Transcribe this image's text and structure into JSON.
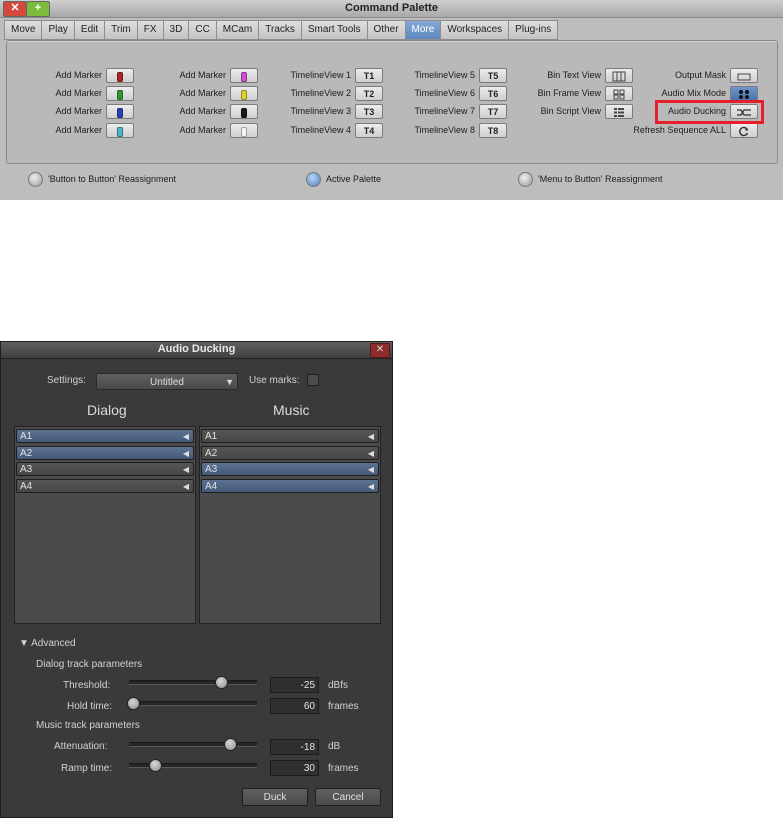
{
  "command_palette": {
    "title": "Command Palette",
    "close_glyph": "✕",
    "add_glyph": "+",
    "tabs": [
      "Move",
      "Play",
      "Edit",
      "Trim",
      "FX",
      "3D",
      "CC",
      "MCam",
      "Tracks",
      "Smart Tools",
      "Other",
      "More",
      "Workspaces",
      "Plug-ins"
    ],
    "active_tab": "More",
    "markers": [
      {
        "label": "Add Marker",
        "color": "#b02525"
      },
      {
        "label": "Add Marker",
        "color": "#2e9a2e"
      },
      {
        "label": "Add Marker",
        "color": "#2b3fbf"
      },
      {
        "label": "Add Marker",
        "color": "#4fb5c9"
      },
      {
        "label": "Add Marker",
        "color": "#d04fd0"
      },
      {
        "label": "Add Marker",
        "color": "#e0d22a"
      },
      {
        "label": "Add Marker",
        "color": "#1a1a1a"
      },
      {
        "label": "Add Marker",
        "color": "#f4f4f4"
      }
    ],
    "timeline_views": [
      {
        "label": "TimelineView 1",
        "btn": "T1"
      },
      {
        "label": "TimelineView 2",
        "btn": "T2"
      },
      {
        "label": "TimelineView 3",
        "btn": "T3"
      },
      {
        "label": "TimelineView 4",
        "btn": "T4"
      },
      {
        "label": "TimelineView 5",
        "btn": "T5"
      },
      {
        "label": "TimelineView 6",
        "btn": "T6"
      },
      {
        "label": "TimelineView 7",
        "btn": "T7"
      },
      {
        "label": "TimelineView 8",
        "btn": "T8"
      }
    ],
    "bin_views": [
      {
        "label": "Bin Text View",
        "icon": "bin-text-view-icon"
      },
      {
        "label": "Bin Frame View",
        "icon": "bin-frame-view-icon"
      },
      {
        "label": "Bin Script View",
        "icon": "bin-script-view-icon"
      }
    ],
    "right_commands": [
      {
        "label": "Output Mask",
        "icon": "output-mask-icon"
      },
      {
        "label": "Audio Mix Mode",
        "icon": "audio-mix-mode-icon"
      },
      {
        "label": "Audio Ducking",
        "icon": "audio-ducking-icon"
      },
      {
        "label": "Refresh Sequence ALL",
        "icon": "refresh-icon"
      }
    ],
    "radios": [
      {
        "label": "'Button to Button' Reassignment",
        "on": false
      },
      {
        "label": "Active Palette",
        "on": true
      },
      {
        "label": "'Menu to Button' Reassignment",
        "on": false
      }
    ]
  },
  "audio_ducking": {
    "title": "Audio Ducking",
    "close_glyph": "✕",
    "settings_label": "Settings:",
    "settings_value": "Untitled",
    "use_marks_label": "Use marks:",
    "dialog_heading": "Dialog",
    "music_heading": "Music",
    "dialog_tracks": [
      {
        "name": "A1",
        "selected": true
      },
      {
        "name": "A2",
        "selected": true
      },
      {
        "name": "A3",
        "selected": false
      },
      {
        "name": "A4",
        "selected": false
      }
    ],
    "music_tracks": [
      {
        "name": "A1",
        "selected": false
      },
      {
        "name": "A2",
        "selected": false
      },
      {
        "name": "A3",
        "selected": true
      },
      {
        "name": "A4",
        "selected": true
      }
    ],
    "advanced_label": "Advanced",
    "dialog_params_label": "Dialog track parameters",
    "music_params_label": "Music track parameters",
    "threshold": {
      "label": "Threshold:",
      "value": "-25",
      "unit": "dBfs",
      "slider": 0.72
    },
    "hold_time": {
      "label": "Hold time:",
      "value": "60",
      "unit": "frames",
      "slider": 0.03
    },
    "attenuation": {
      "label": "Attenuation:",
      "value": "-18",
      "unit": "dB",
      "slider": 0.79
    },
    "ramp_time": {
      "label": "Ramp time:",
      "value": "30",
      "unit": "frames",
      "slider": 0.2
    },
    "duck_button": "Duck",
    "cancel_button": "Cancel"
  }
}
